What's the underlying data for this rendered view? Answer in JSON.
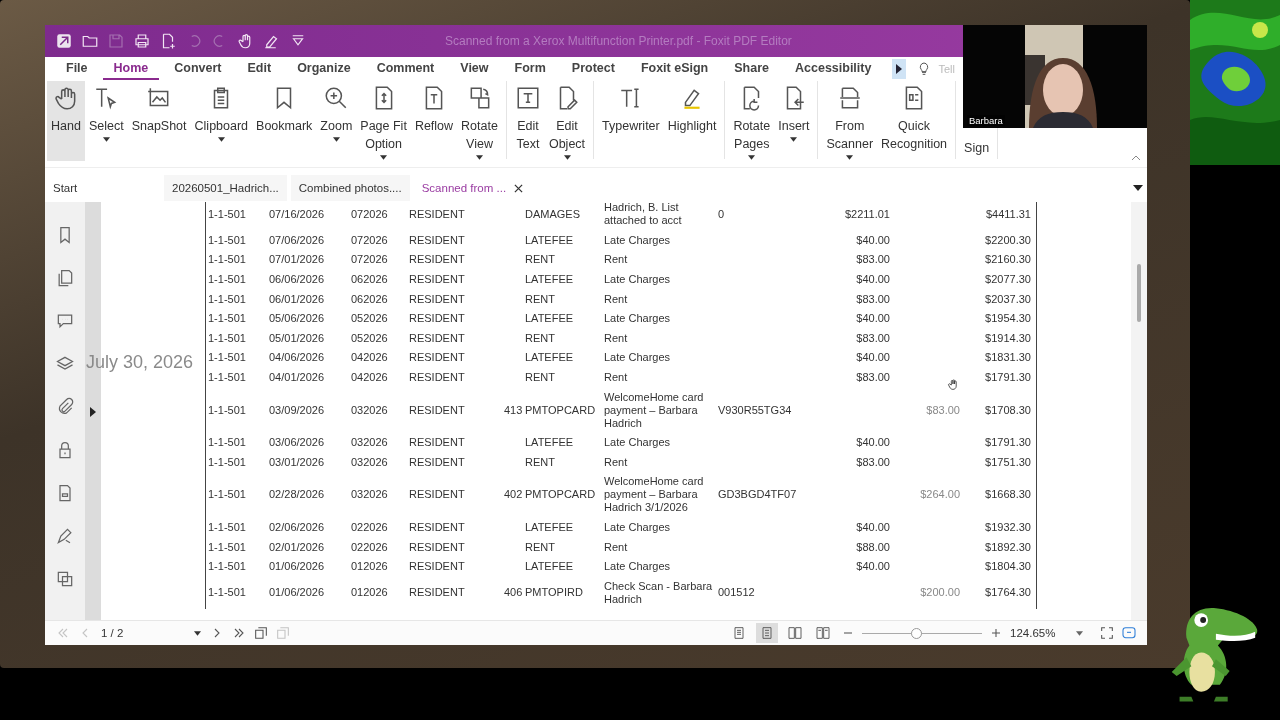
{
  "window": {
    "title": "Scanned from a Xerox Multifunction Printer.pdf - Foxit PDF Editor"
  },
  "menu_tabs": [
    {
      "label": "File",
      "selected": false
    },
    {
      "label": "Home",
      "selected": true
    },
    {
      "label": "Convert",
      "selected": false
    },
    {
      "label": "Edit",
      "selected": false
    },
    {
      "label": "Organize",
      "selected": false
    },
    {
      "label": "Comment",
      "selected": false
    },
    {
      "label": "View",
      "selected": false
    },
    {
      "label": "Form",
      "selected": false
    },
    {
      "label": "Protect",
      "selected": false
    },
    {
      "label": "Foxit eSign",
      "selected": false
    },
    {
      "label": "Share",
      "selected": false
    },
    {
      "label": "Accessibility",
      "selected": false
    }
  ],
  "tell_me": {
    "placeholder": "Tell"
  },
  "ribbon": {
    "groups": [
      {
        "tools": [
          {
            "label": "Hand",
            "dropdown": false,
            "selected": true
          },
          {
            "label": "Select",
            "dropdown": true,
            "selected": false
          },
          {
            "label": "SnapShot",
            "dropdown": false,
            "selected": false
          },
          {
            "label": "Clipboard",
            "dropdown": true,
            "selected": false
          },
          {
            "label": "Bookmark",
            "dropdown": false,
            "selected": false
          },
          {
            "label": "Zoom",
            "dropdown": true,
            "selected": false
          },
          {
            "label": "Page Fit\nOption",
            "dropdown": true,
            "selected": false
          },
          {
            "label": "Reflow",
            "dropdown": false,
            "selected": false
          },
          {
            "label": "Rotate\nView",
            "dropdown": true,
            "selected": false
          }
        ]
      },
      {
        "tools": [
          {
            "label": "Edit\nText",
            "dropdown": false,
            "selected": false
          },
          {
            "label": "Edit\nObject",
            "dropdown": true,
            "selected": false
          }
        ]
      },
      {
        "tools": [
          {
            "label": "Typewriter",
            "dropdown": false,
            "selected": false
          },
          {
            "label": "Highlight",
            "dropdown": false,
            "selected": false
          }
        ]
      },
      {
        "tools": [
          {
            "label": "Rotate\nPages",
            "dropdown": true,
            "selected": false
          },
          {
            "label": "Insert",
            "dropdown": true,
            "selected": false
          }
        ]
      },
      {
        "tools": [
          {
            "label": "From\nScanner",
            "dropdown": true,
            "selected": false
          },
          {
            "label": "Quick\nRecognition",
            "dropdown": false,
            "selected": false
          }
        ]
      },
      {
        "tools": [
          {
            "label": "Sign",
            "dropdown": false,
            "selected": false
          }
        ]
      }
    ]
  },
  "doc_tabs": {
    "start": "Start",
    "tabs": [
      {
        "label": "20260501_Hadrich...",
        "selected": false
      },
      {
        "label": "Combined photos....",
        "selected": false
      },
      {
        "label": "Scanned from ...",
        "selected": true
      }
    ]
  },
  "page": {
    "overlay_date": "July 30, 2026",
    "rows": [
      {
        "column_1": "1-1-501",
        "column_2": "07/16/2026",
        "column_3": "072026",
        "column_4": "RESIDENT",
        "column_6": "DAMAGES",
        "column_7": "Hadrich, B. List attached to acct",
        "column_8": "0",
        "column_9": "$2211.01",
        "column_11": "$4411.31"
      },
      {
        "column_1": "1-1-501",
        "column_2": "07/06/2026",
        "column_3": "072026",
        "column_4": "RESIDENT",
        "column_6": "LATEFEE",
        "column_7": "Late Charges",
        "column_9": "$40.00",
        "column_11": "$2200.30"
      },
      {
        "column_1": "1-1-501",
        "column_2": "07/01/2026",
        "column_3": "072026",
        "column_4": "RESIDENT",
        "column_6": "RENT",
        "column_7": "Rent",
        "column_9": "$83.00",
        "column_11": "$2160.30"
      },
      {
        "column_1": "1-1-501",
        "column_2": "06/06/2026",
        "column_3": "062026",
        "column_4": "RESIDENT",
        "column_6": "LATEFEE",
        "column_7": "Late Charges",
        "column_9": "$40.00",
        "column_11": "$2077.30"
      },
      {
        "column_1": "1-1-501",
        "column_2": "06/01/2026",
        "column_3": "062026",
        "column_4": "RESIDENT",
        "column_6": "RENT",
        "column_7": "Rent",
        "column_9": "$83.00",
        "column_11": "$2037.30"
      },
      {
        "column_1": "1-1-501",
        "column_2": "05/06/2026",
        "column_3": "052026",
        "column_4": "RESIDENT",
        "column_6": "LATEFEE",
        "column_7": "Late Charges",
        "column_9": "$40.00",
        "column_11": "$1954.30"
      },
      {
        "column_1": "1-1-501",
        "column_2": "05/01/2026",
        "column_3": "052026",
        "column_4": "RESIDENT",
        "column_6": "RENT",
        "column_7": "Rent",
        "column_9": "$83.00",
        "column_11": "$1914.30"
      },
      {
        "column_1": "1-1-501",
        "column_2": "04/06/2026",
        "column_3": "042026",
        "column_4": "RESIDENT",
        "column_6": "LATEFEE",
        "column_7": "Late Charges",
        "column_9": "$40.00",
        "column_11": "$1831.30"
      },
      {
        "column_1": "1-1-501",
        "column_2": "04/01/2026",
        "column_3": "042026",
        "column_4": "RESIDENT",
        "column_6": "RENT",
        "column_7": "Rent",
        "column_9": "$83.00",
        "column_11": "$1791.30"
      },
      {
        "column_1": "1-1-501",
        "column_2": "03/09/2026",
        "column_3": "032026",
        "column_4": "RESIDENT",
        "column_5": "413",
        "column_6": "PMTOPCARD",
        "column_7": "WelcomeHome card payment – Barbara Hadrich",
        "column_8": "V930R55TG34",
        "column_10": "$83.00",
        "column_11": "$1708.30"
      },
      {
        "column_1": "1-1-501",
        "column_2": "03/06/2026",
        "column_3": "032026",
        "column_4": "RESIDENT",
        "column_6": "LATEFEE",
        "column_7": "Late Charges",
        "column_9": "$40.00",
        "column_11": "$1791.30"
      },
      {
        "column_1": "1-1-501",
        "column_2": "03/01/2026",
        "column_3": "032026",
        "column_4": "RESIDENT",
        "column_6": "RENT",
        "column_7": "Rent",
        "column_9": "$83.00",
        "column_11": "$1751.30"
      },
      {
        "column_1": "1-1-501",
        "column_2": "02/28/2026",
        "column_3": "032026",
        "column_4": "RESIDENT",
        "column_5": "402",
        "column_6": "PMTOPCARD",
        "column_7": "WelcomeHome card payment – Barbara Hadrich 3/1/2026",
        "column_8": "GD3BGD4TF07",
        "column_10": "$264.00",
        "column_11": "$1668.30"
      },
      {
        "column_1": "1-1-501",
        "column_2": "02/06/2026",
        "column_3": "022026",
        "column_4": "RESIDENT",
        "column_6": "LATEFEE",
        "column_7": "Late Charges",
        "column_9": "$40.00",
        "column_11": "$1932.30"
      },
      {
        "column_1": "1-1-501",
        "column_2": "02/01/2026",
        "column_3": "022026",
        "column_4": "RESIDENT",
        "column_6": "RENT",
        "column_7": "Rent",
        "column_9": "$88.00",
        "column_11": "$1892.30"
      },
      {
        "column_1": "1-1-501",
        "column_2": "01/06/2026",
        "column_3": "012026",
        "column_4": "RESIDENT",
        "column_6": "LATEFEE",
        "column_7": "Late Charges",
        "column_9": "$40.00",
        "column_11": "$1804.30"
      },
      {
        "column_1": "1-1-501",
        "column_2": "01/06/2026",
        "column_3": "012026",
        "column_4": "RESIDENT",
        "column_5": "406",
        "column_6": "PMTOPIRD",
        "column_7": "Check Scan - Barbara Hadrich",
        "column_8": "001512",
        "column_10": "$200.00",
        "column_11": "$1764.30"
      }
    ]
  },
  "status_bar": {
    "page": "1 / 2",
    "view_modes": [
      {
        "selected": false
      },
      {
        "selected": true
      },
      {
        "selected": false
      },
      {
        "selected": false
      }
    ],
    "zoom_level": {
      "level": 0.45
    },
    "zoom": "124.65%"
  },
  "webcam": {
    "name": "Barbara"
  }
}
